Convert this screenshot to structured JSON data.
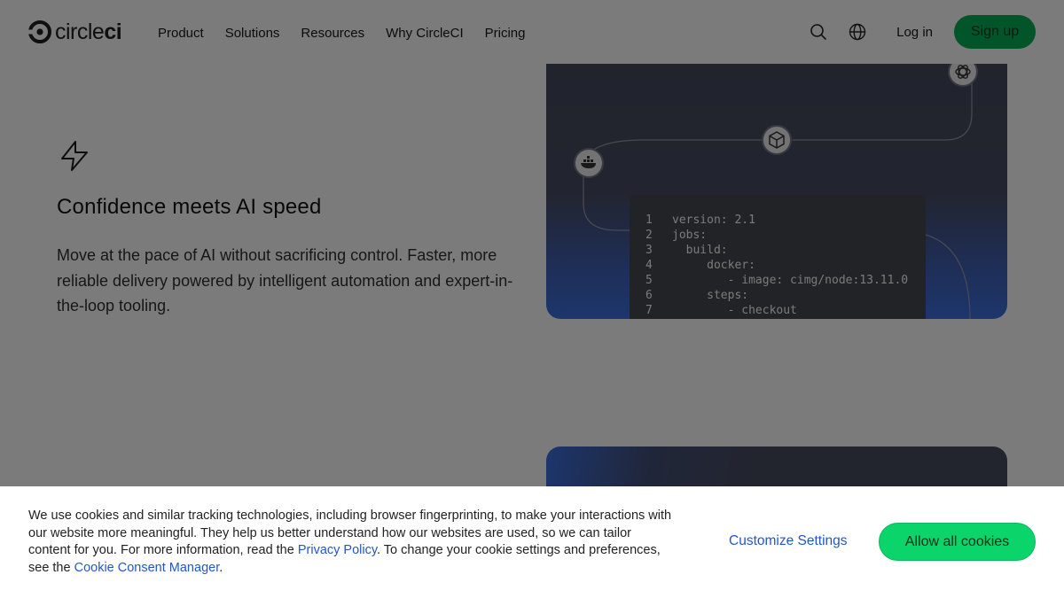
{
  "header": {
    "logo_text_a": "circle",
    "logo_text_b": "ci",
    "nav": [
      "Product",
      "Solutions",
      "Resources",
      "Why CircleCI",
      "Pricing"
    ],
    "login": "Log in",
    "signup": "Sign up",
    "icons": [
      "search-icon",
      "globe-icon"
    ]
  },
  "feature": {
    "icon": "lightning-icon",
    "title": "Confidence meets AI speed",
    "description": "Move at the pace of AI without sacrificing control. Faster, more reliable delivery powered by intelligent automation and expert-in-the-loop tooling."
  },
  "code": [
    {
      "n": "1",
      "t": "version: 2.1"
    },
    {
      "n": "2",
      "t": "jobs:"
    },
    {
      "n": "3",
      "t": "  build:"
    },
    {
      "n": "4",
      "t": "     docker:"
    },
    {
      "n": "5",
      "t": "        - image: cimg/node:13.11.0"
    },
    {
      "n": "6",
      "t": "     steps:"
    },
    {
      "n": "7",
      "t": "        - checkout"
    }
  ],
  "cookie": {
    "text_1": "We use cookies and similar tracking technologies, including browser fingerprinting, to make your interactions with our website more meaningful. They help us better understand how our websites are used, so we can tailor content for you. For more information, read the ",
    "privacy_link": "Privacy Policy",
    "text_2": ". To change your cookie settings and preferences, see the ",
    "consent_link": "Cookie Consent Manager",
    "text_3": ".",
    "customize": "Customize Settings",
    "allow": "Allow all cookies"
  },
  "colors": {
    "brand_green": "#04aa51",
    "allow_green": "#0bd46a",
    "link_blue": "#2456c8"
  }
}
